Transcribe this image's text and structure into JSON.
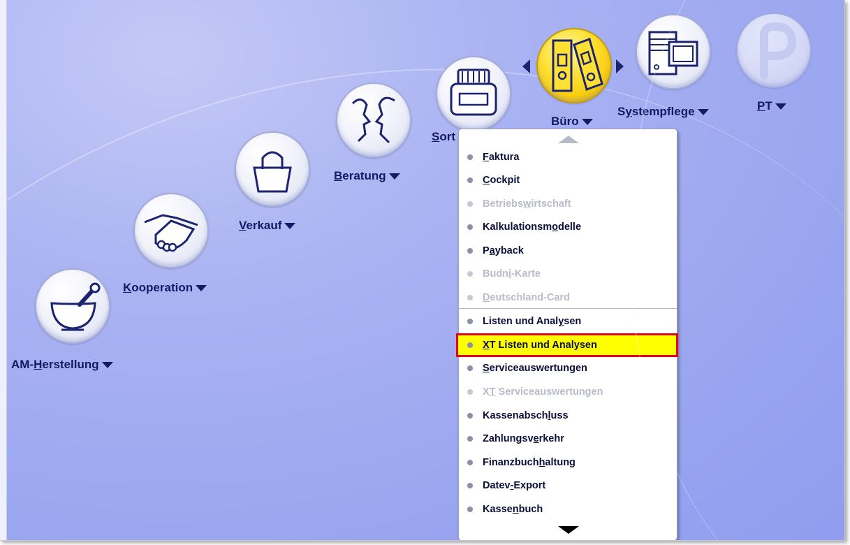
{
  "modules": [
    {
      "id": "am",
      "label_pre": "AM-",
      "label_u": "H",
      "label_post": "erstellung",
      "icon": "mortar-icon"
    },
    {
      "id": "kooperation",
      "label_pre": "",
      "label_u": "K",
      "label_post": "ooperation",
      "icon": "handshake-icon"
    },
    {
      "id": "verkauf",
      "label_pre": "",
      "label_u": "V",
      "label_post": "erkauf",
      "icon": "shopping-bag-icon"
    },
    {
      "id": "beratung",
      "label_pre": "",
      "label_u": "B",
      "label_post": "eratung",
      "icon": "faces-icon"
    },
    {
      "id": "sortiment",
      "label_pre": "",
      "label_u": "S",
      "label_post": "ort",
      "icon": "jar-icon"
    },
    {
      "id": "buero",
      "label_pre": "Büro",
      "label_u": "",
      "label_post": "",
      "icon": "binders-icon"
    },
    {
      "id": "systempflege",
      "label_pre": "S",
      "label_u": "y",
      "label_post": "stempflege",
      "icon": "computer-icon"
    },
    {
      "id": "pt",
      "label_pre": "",
      "label_u": "P",
      "label_post": "T",
      "icon": "p-logo-icon"
    }
  ],
  "menu": {
    "items": [
      {
        "pre": "",
        "u": "F",
        "post": "aktura",
        "state": "enabled"
      },
      {
        "pre": "",
        "u": "C",
        "post": "ockpit",
        "state": "enabled"
      },
      {
        "pre": "Betriebs",
        "u": "w",
        "post": "irtschaft",
        "state": "disabled"
      },
      {
        "pre": "Kalkulationsm",
        "u": "o",
        "post": "delle",
        "state": "enabled"
      },
      {
        "pre": "P",
        "u": "a",
        "post": "yback",
        "state": "enabled"
      },
      {
        "pre": "Budn",
        "u": "i",
        "post": "-Karte",
        "state": "disabled"
      },
      {
        "pre": "",
        "u": "D",
        "post": "eutschland-Card",
        "state": "disabled"
      },
      {
        "pre": "Listen und Anal",
        "u": "y",
        "post": "sen",
        "state": "enabled"
      },
      {
        "pre": "",
        "u": "X",
        "post": "T Listen und Analysen",
        "state": "selected"
      },
      {
        "pre": "",
        "u": "S",
        "post": "erviceauswertungen",
        "state": "enabled"
      },
      {
        "pre": "X",
        "u": "T",
        "post": " Serviceauswertungen",
        "state": "disabled"
      },
      {
        "pre": "Kassenabsch",
        "u": "l",
        "post": "uss",
        "state": "enabled"
      },
      {
        "pre": "Zahlungsv",
        "u": "e",
        "post": "rkehr",
        "state": "enabled"
      },
      {
        "pre": "Finanzbuch",
        "u": "h",
        "post": "altung",
        "state": "enabled"
      },
      {
        "pre": "Datev",
        "u": "-",
        "post": "Export",
        "state": "enabled"
      },
      {
        "pre": "Kasse",
        "u": "n",
        "post": "buch",
        "state": "enabled"
      }
    ]
  },
  "colors": {
    "background": "#9aa6ef",
    "label": "#141a63",
    "selected_fill": "#ffff00",
    "selected_border": "#e30613",
    "active_circle": "#ffe033"
  }
}
